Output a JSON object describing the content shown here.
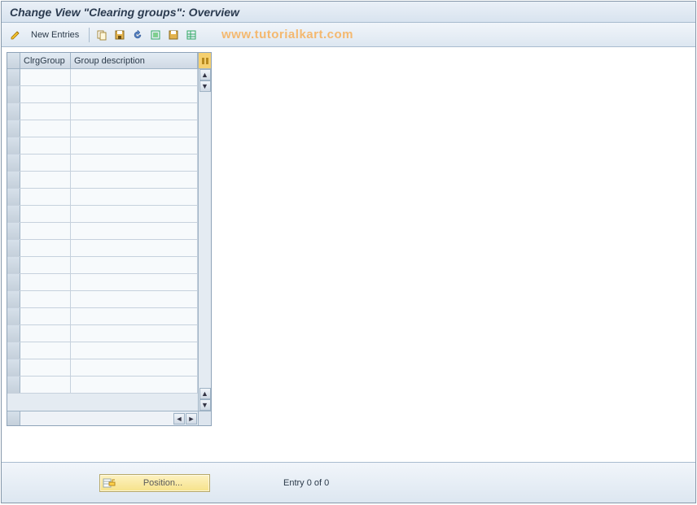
{
  "title": "Change View \"Clearing groups\": Overview",
  "watermark": "www.tutorialkart.com",
  "toolbar": {
    "new_entries_label": "New Entries"
  },
  "grid": {
    "columns": {
      "code": "ClrgGroup",
      "desc": "Group description"
    },
    "row_count": 19
  },
  "footer": {
    "position_label": "Position...",
    "entry_text": "Entry 0 of 0"
  }
}
